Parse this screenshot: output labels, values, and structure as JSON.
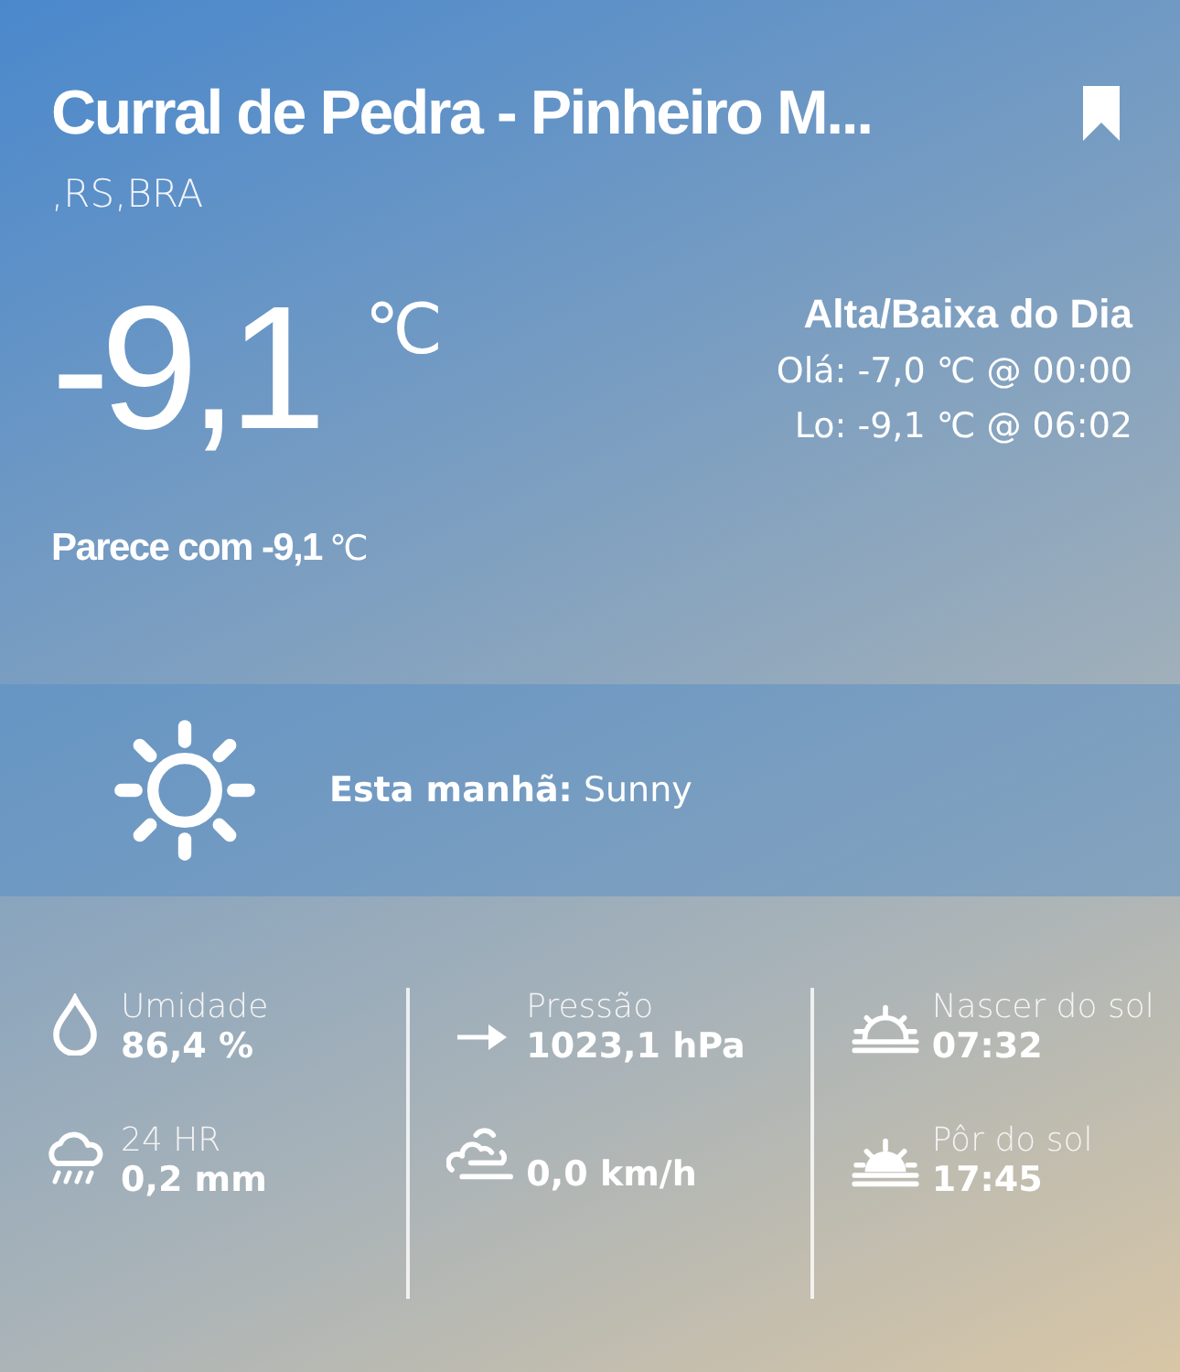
{
  "location": {
    "title": "Curral de Pedra - Pinheiro M...",
    "bookmarked": true,
    "subtitle": ",RS,BRA"
  },
  "current": {
    "temperature": "-9,1",
    "unit": "℃",
    "feels_like": "Parece com -9,1",
    "feels_unit": "℃"
  },
  "high_low": {
    "heading": "Alta/Baixa do Dia",
    "lines": [
      "Olá: -7,0 ℃ @ 00:00",
      "Lo: -9,1 ℃ @ 06:02"
    ]
  },
  "forecast": {
    "kind": "sun",
    "label": "Esta manhã:",
    "condition": "Sunny"
  },
  "details": [
    [
      {
        "kind": "drop",
        "label": "Umidade",
        "value": "86,4 %"
      },
      {
        "kind": "rain",
        "label": "24 HR",
        "value": "0,2 mm"
      }
    ],
    [
      {
        "kind": "arrow",
        "label": "Pressão",
        "value": "1023,1 hPa"
      },
      {
        "kind": "wind",
        "value": "0,0 km/h"
      }
    ],
    [
      {
        "kind": "sunrise",
        "label": "Nascer do sol",
        "value": "07:32"
      },
      {
        "kind": "sunset",
        "label": "Pôr do sol",
        "value": "17:45"
      }
    ]
  ]
}
